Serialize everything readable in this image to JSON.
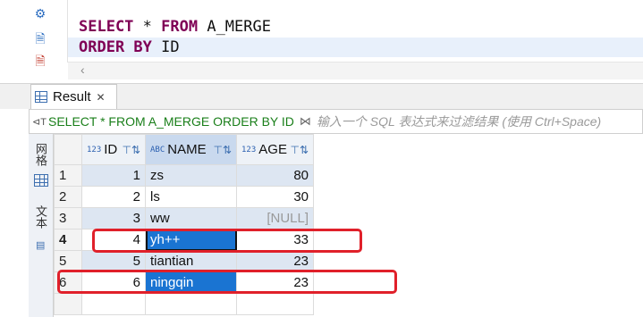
{
  "editor": {
    "line1": {
      "kw1": "SELECT",
      "rest1": " * ",
      "kw2": "FROM",
      "rest2": " A_MERGE"
    },
    "line2": {
      "kw1": "ORDER BY",
      "rest1": " ID"
    },
    "gutter_icons": [
      "gear-icon",
      "script-icon",
      "script-warning-icon"
    ]
  },
  "result_tab": {
    "label": "Result",
    "close": "✕"
  },
  "filter": {
    "query": "SELECT * FROM A_MERGE ORDER BY ID",
    "placeholder": "输入一个 SQL 表达式来过滤结果 (使用 Ctrl+Space)"
  },
  "side_tabs": {
    "grid": "网格",
    "text": "文本"
  },
  "columns": [
    {
      "name": "ID",
      "type": "123"
    },
    {
      "name": "NAME",
      "type": "ABC"
    },
    {
      "name": "AGE",
      "type": "123"
    }
  ],
  "rows": [
    {
      "rn": "1",
      "id": "1",
      "name": "zs",
      "age": "80"
    },
    {
      "rn": "2",
      "id": "2",
      "name": "ls",
      "age": "30"
    },
    {
      "rn": "3",
      "id": "3",
      "name": "ww",
      "age": "[NULL]"
    },
    {
      "rn": "4",
      "id": "4",
      "name": "yh++",
      "age": "33"
    },
    {
      "rn": "5",
      "id": "5",
      "name": "tiantian",
      "age": "23"
    },
    {
      "rn": "6",
      "id": "6",
      "name": "ningqin",
      "age": "23"
    }
  ],
  "colors": {
    "selection": "#1a74d2",
    "highlight_box": "#e0202a",
    "keyword": "#7f0055",
    "filter_query": "#1a7f1a"
  }
}
